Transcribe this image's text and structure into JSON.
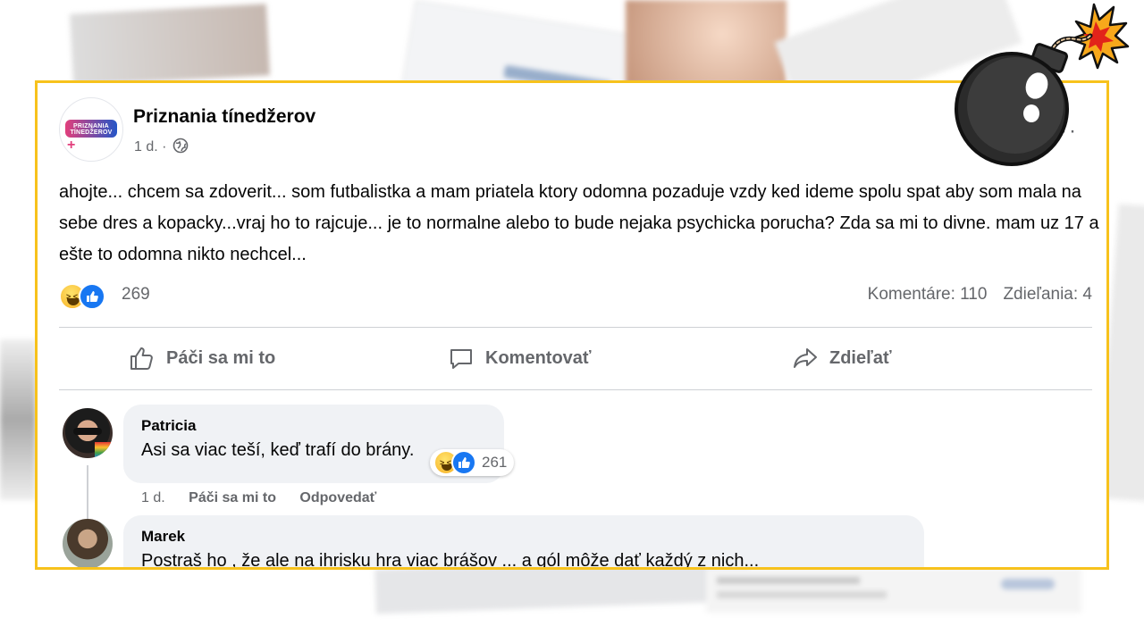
{
  "post": {
    "page_name": "Priznania tínedžerov",
    "avatar_text": "PRIZNANIA TÍNEDŽEROV",
    "time": "1 d.",
    "separator": "·",
    "body": "ahojte... chcem sa zdoverit... som futbalistka a mam priatela ktory odomna pozaduje vzdy ked ideme spolu spat aby som mala na sebe dres a kopacky...vraj ho to rajcuje... je to normalne alebo to bude nejaka psychicka porucha? Zda sa mi to divne. mam uz 17 a ešte to odomna nikto nechcel...",
    "reaction_count": "269",
    "comments_stat": "Komentáre: 110",
    "shares_stat": "Zdieľania: 4",
    "more": "···"
  },
  "actions": {
    "like": "Páči sa mi to",
    "comment": "Komentovať",
    "share": "Zdieľať"
  },
  "comments": [
    {
      "author": "Patricia",
      "text": "Asi sa viac teší, keď trafí do brány.",
      "reaction_count": "261",
      "time": "1 d.",
      "like_label": "Páči sa mi to",
      "reply_label": "Odpovedať"
    },
    {
      "author": "Marek",
      "text": "Postraš ho , že ale na ihrisku hra viac brášov ... a gól môže dať každý z nich..."
    }
  ],
  "colors": {
    "frame": "#f7c21c",
    "like_blue": "#1877f2",
    "secondary_text": "#65676b",
    "bubble_bg": "#f0f2f5"
  },
  "icons": [
    "globe-icon",
    "like-icon",
    "comment-icon",
    "share-icon",
    "haha-reaction-icon",
    "like-reaction-icon",
    "bomb-icon"
  ]
}
